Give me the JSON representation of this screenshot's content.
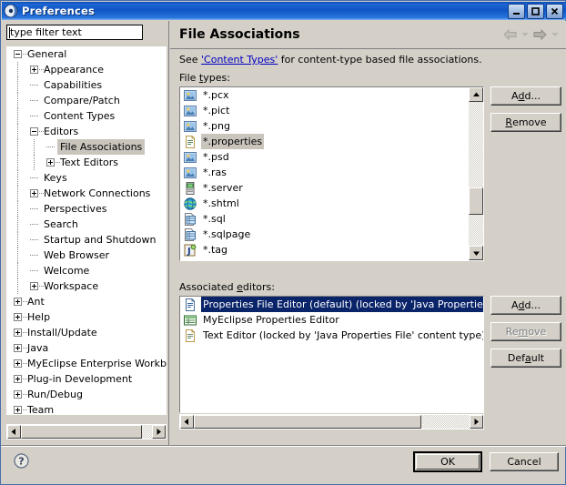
{
  "window": {
    "title": "Preferences",
    "icon": "preferences-icon",
    "buttons": [
      {
        "name": "minimize-button",
        "label": "Minimize"
      },
      {
        "name": "maximize-button",
        "label": "Maximize"
      },
      {
        "name": "close-button",
        "label": "Close"
      }
    ]
  },
  "sidebar": {
    "filter": {
      "value": "type filter text",
      "placeholder": "type filter text"
    },
    "tree": [
      {
        "label": "General",
        "level": 0,
        "expander": "minus",
        "selected": false
      },
      {
        "label": "Appearance",
        "level": 1,
        "expander": "plus",
        "selected": false
      },
      {
        "label": "Capabilities",
        "level": 1,
        "expander": "none",
        "selected": false
      },
      {
        "label": "Compare/Patch",
        "level": 1,
        "expander": "none",
        "selected": false
      },
      {
        "label": "Content Types",
        "level": 1,
        "expander": "none",
        "selected": false
      },
      {
        "label": "Editors",
        "level": 1,
        "expander": "minus",
        "selected": false
      },
      {
        "label": "File Associations",
        "level": 2,
        "expander": "none",
        "selected": true
      },
      {
        "label": "Text Editors",
        "level": 2,
        "expander": "plus",
        "selected": false
      },
      {
        "label": "Keys",
        "level": 1,
        "expander": "none",
        "selected": false
      },
      {
        "label": "Network Connections",
        "level": 1,
        "expander": "plus",
        "selected": false
      },
      {
        "label": "Perspectives",
        "level": 1,
        "expander": "none",
        "selected": false
      },
      {
        "label": "Search",
        "level": 1,
        "expander": "none",
        "selected": false
      },
      {
        "label": "Startup and Shutdown",
        "level": 1,
        "expander": "none",
        "selected": false
      },
      {
        "label": "Web Browser",
        "level": 1,
        "expander": "none",
        "selected": false
      },
      {
        "label": "Welcome",
        "level": 1,
        "expander": "none",
        "selected": false
      },
      {
        "label": "Workspace",
        "level": 1,
        "expander": "plus",
        "selected": false
      },
      {
        "label": "Ant",
        "level": 0,
        "expander": "plus",
        "selected": false
      },
      {
        "label": "Help",
        "level": 0,
        "expander": "plus",
        "selected": false
      },
      {
        "label": "Install/Update",
        "level": 0,
        "expander": "plus",
        "selected": false
      },
      {
        "label": "Java",
        "level": 0,
        "expander": "plus",
        "selected": false
      },
      {
        "label": "MyEclipse Enterprise Workbenc",
        "level": 0,
        "expander": "plus",
        "selected": false
      },
      {
        "label": "Plug-in Development",
        "level": 0,
        "expander": "plus",
        "selected": false
      },
      {
        "label": "Run/Debug",
        "level": 0,
        "expander": "plus",
        "selected": false
      },
      {
        "label": "Team",
        "level": 0,
        "expander": "plus",
        "selected": false
      }
    ]
  },
  "page": {
    "title": "File Associations",
    "nav": [
      {
        "name": "back-arrow-icon",
        "label": "Back"
      },
      {
        "name": "back-dropdown-icon",
        "label": "Back history"
      },
      {
        "name": "forward-arrow-icon",
        "label": "Forward"
      },
      {
        "name": "forward-dropdown-icon",
        "label": "Forward history"
      }
    ],
    "hint_before": "See ",
    "hint_link": "'Content Types'",
    "hint_after": " for content-type based file associations.",
    "file_types_label": "File types:",
    "file_types": [
      {
        "name": "*.pcx",
        "icon": "image-file-icon",
        "selected": false
      },
      {
        "name": "*.pict",
        "icon": "image-file-icon",
        "selected": false
      },
      {
        "name": "*.png",
        "icon": "image-file-icon",
        "selected": false
      },
      {
        "name": "*.properties",
        "icon": "text-file-icon",
        "selected": true
      },
      {
        "name": "*.psd",
        "icon": "image-file-icon",
        "selected": false
      },
      {
        "name": "*.ras",
        "icon": "image-file-icon",
        "selected": false
      },
      {
        "name": "*.server",
        "icon": "server-file-icon",
        "selected": false
      },
      {
        "name": "*.shtml",
        "icon": "globe-file-icon",
        "selected": false
      },
      {
        "name": "*.sql",
        "icon": "sql-file-icon",
        "selected": false
      },
      {
        "name": "*.sqlpage",
        "icon": "sql-file-icon",
        "selected": false
      },
      {
        "name": "*.tag",
        "icon": "tag-file-icon",
        "selected": false
      }
    ],
    "file_type_buttons": [
      {
        "name": "add-file-type-button",
        "label": "Add...",
        "mnemonic": "A",
        "disabled": false
      },
      {
        "name": "remove-file-type-button",
        "label": "Remove",
        "mnemonic": "R",
        "disabled": false
      }
    ],
    "editors_label": "Associated editors:",
    "editors": [
      {
        "name": "Properties File Editor (default) (locked by 'Java Properties File' co",
        "icon": "properties-editor-icon",
        "selected": true
      },
      {
        "name": "MyEclipse Properties Editor",
        "icon": "table-editor-icon",
        "selected": false
      },
      {
        "name": "Text Editor (locked by 'Java Properties File' content type)",
        "icon": "text-editor-icon",
        "selected": false
      }
    ],
    "editor_buttons": [
      {
        "name": "add-editor-button",
        "label": "Add...",
        "mnemonic": "d",
        "disabled": false
      },
      {
        "name": "remove-editor-button",
        "label": "Remove",
        "mnemonic": "m",
        "disabled": true
      },
      {
        "name": "default-editor-button",
        "label": "Default",
        "mnemonic": "a",
        "disabled": false
      }
    ]
  },
  "footer": {
    "help": {
      "name": "help-icon",
      "label": "?"
    },
    "ok": "OK",
    "cancel": "Cancel"
  }
}
